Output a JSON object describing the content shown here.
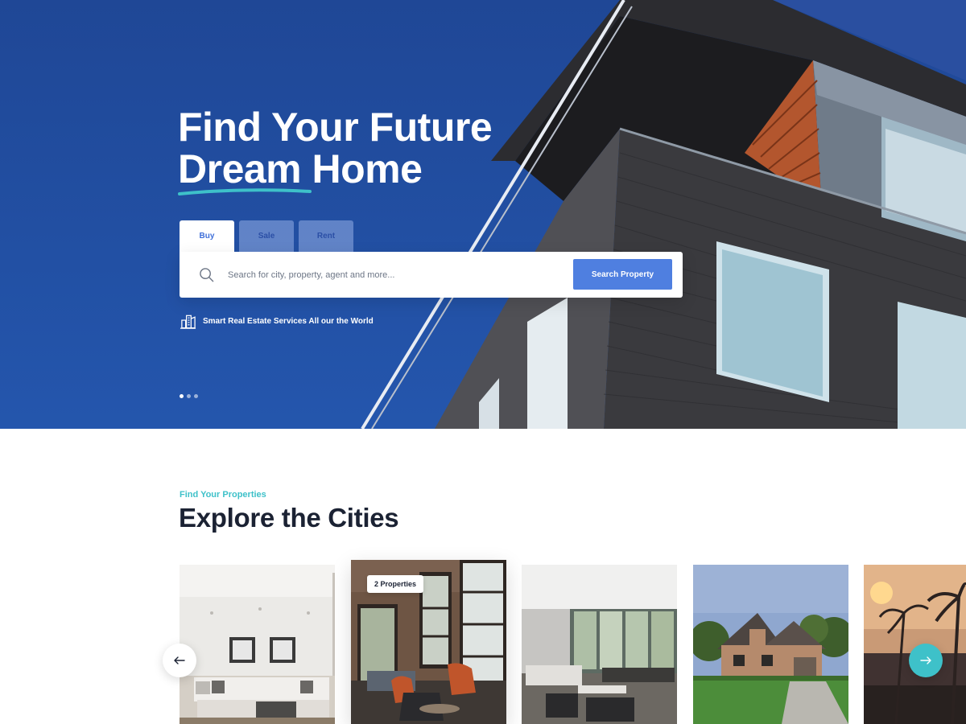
{
  "hero": {
    "title_line1": "Find Your Future",
    "title_highlight": "Dream",
    "title_rest": " Home",
    "tabs": [
      {
        "label": "Buy",
        "active": true
      },
      {
        "label": "Sale",
        "active": false
      },
      {
        "label": "Rent",
        "active": false
      }
    ],
    "search": {
      "placeholder": "Search for city, property, agent and more...",
      "button_label": "Search Property"
    },
    "tagline": "Smart Real Estate Services All our the World",
    "slide_count": 3,
    "active_slide": 1
  },
  "cities": {
    "eyebrow": "Find Your Properties",
    "title": "Explore the Cities",
    "cards": [
      {
        "image": "living-room-photo"
      },
      {
        "image": "loft-lounge-photo",
        "badge": "2 Properties"
      },
      {
        "image": "open-living-room-photo"
      },
      {
        "image": "house-exterior-photo"
      },
      {
        "image": "palm-beach-sunset-photo"
      }
    ]
  },
  "colors": {
    "hero_blue": "#2456ad",
    "accent_teal": "#3ec1c9",
    "button_blue": "#4f7fe0",
    "heading_dark": "#1b2233"
  },
  "icons": [
    "search-icon",
    "building-icon",
    "arrow-left-icon",
    "arrow-right-icon"
  ]
}
